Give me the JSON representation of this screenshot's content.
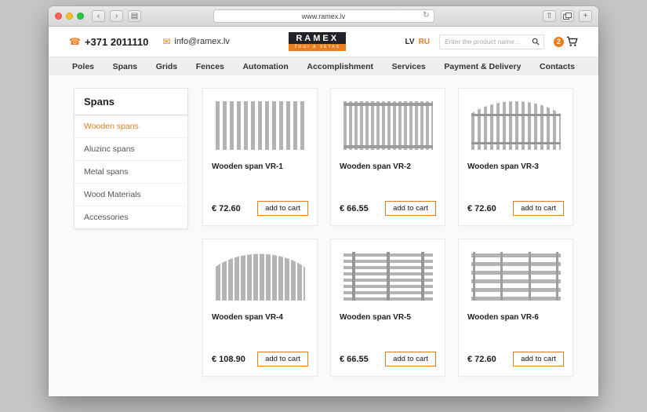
{
  "browser": {
    "url": "www.ramex.lv",
    "back_glyph": "‹",
    "forward_glyph": "›",
    "reader_glyph": "▤",
    "refresh_glyph": "↻",
    "share_glyph": "⇧",
    "new_tab_glyph": "+"
  },
  "header": {
    "phone": "+371 2011110",
    "phone_icon_glyph": "☎",
    "email": "info@ramex.lv",
    "email_icon_glyph": "✉",
    "logo_title": "RAMEX",
    "logo_subtitle": "ŽOGI & SĒTAS",
    "lang_lv": "LV",
    "lang_ru": "RU",
    "search_placeholder": "Enter the product name...",
    "cart_count": "2"
  },
  "nav": {
    "items": [
      "Poles",
      "Spans",
      "Grids",
      "Fences",
      "Automation",
      "Accomplishment",
      "Services",
      "Payment & Delivery",
      "Contacts"
    ]
  },
  "sidebar": {
    "title": "Spans",
    "items": [
      {
        "label": "Wooden spans",
        "active": true
      },
      {
        "label": "Aluzinc spans",
        "active": false
      },
      {
        "label": "Metal spans",
        "active": false
      },
      {
        "label": "Wood Materials",
        "active": false
      },
      {
        "label": "Accessories",
        "active": false
      }
    ]
  },
  "catalog": {
    "add_to_cart_label": "add to cart",
    "products": [
      {
        "name": "Wooden span VR-1",
        "price": "€ 72.60",
        "fence_type": "vr1"
      },
      {
        "name": "Wooden span VR-2",
        "price": "€ 66.55",
        "fence_type": "vr2"
      },
      {
        "name": "Wooden span VR-3",
        "price": "€ 72.60",
        "fence_type": "vr3"
      },
      {
        "name": "Wooden span VR-4",
        "price": "€ 108.90",
        "fence_type": "vr4"
      },
      {
        "name": "Wooden span VR-5",
        "price": "€ 66.55",
        "fence_type": "vr5"
      },
      {
        "name": "Wooden span VR-6",
        "price": "€ 72.60",
        "fence_type": "vr6"
      }
    ]
  },
  "colors": {
    "accent_orange": "#e87e1e",
    "logo_dark": "#222226",
    "fence_gray": "#b2b2b2"
  }
}
